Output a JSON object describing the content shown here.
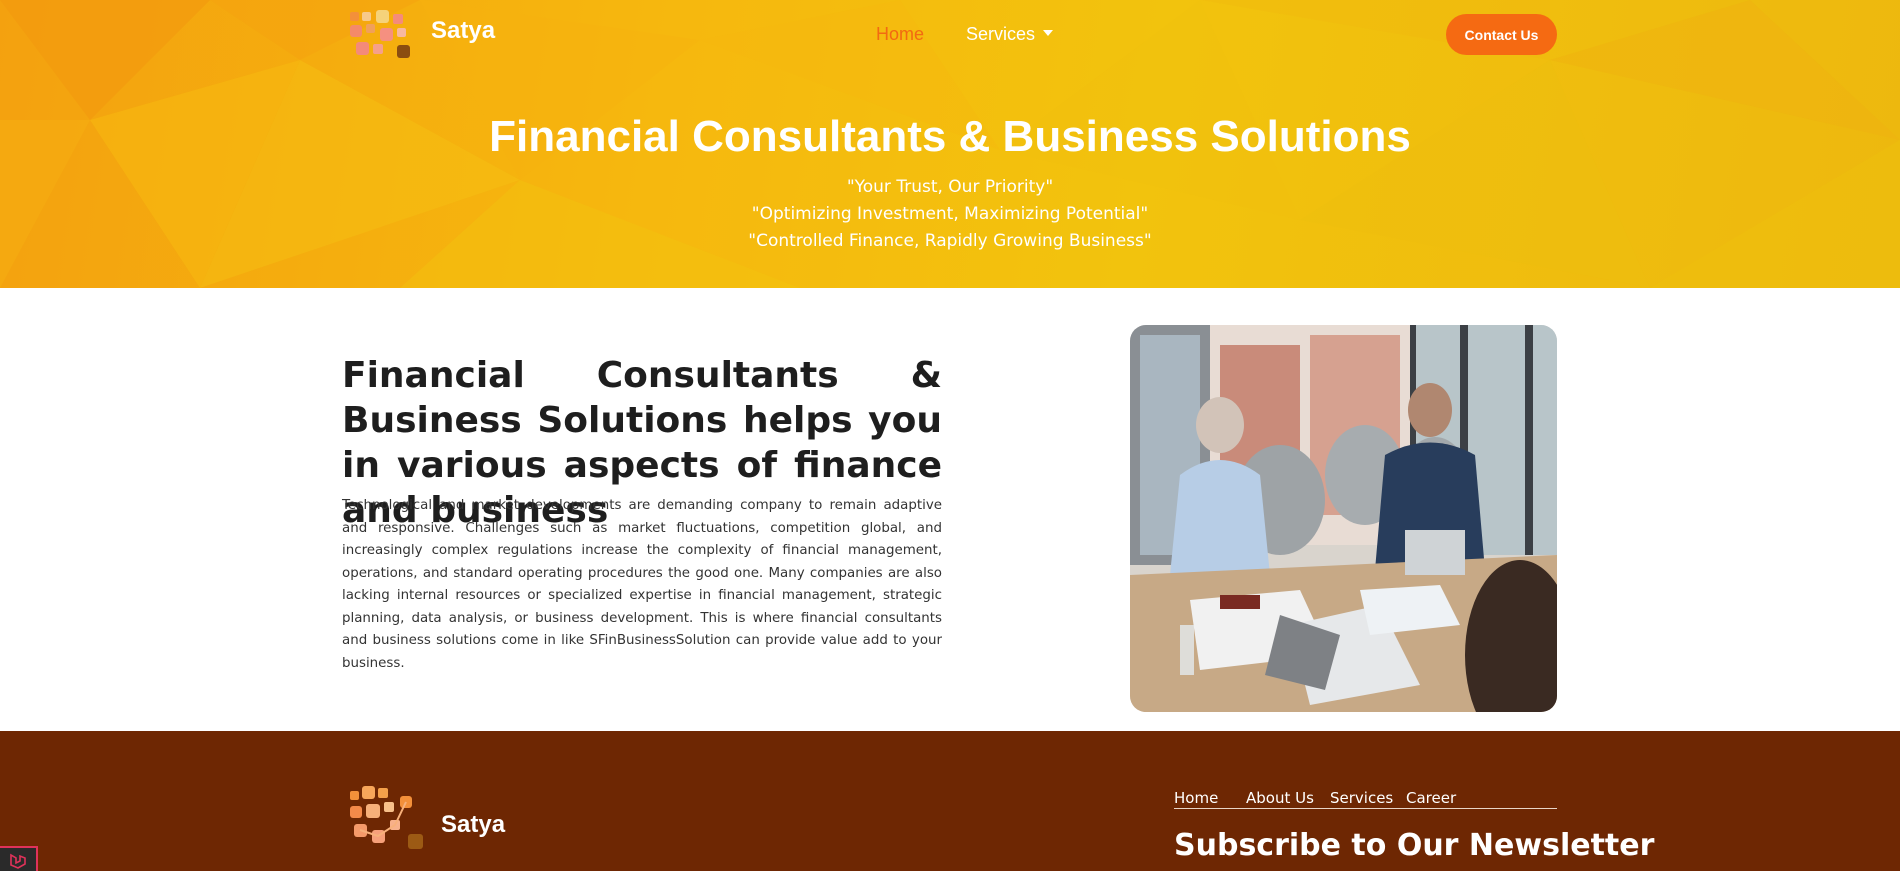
{
  "header": {
    "brand": "Satya",
    "nav": {
      "home": "Home",
      "services": "Services"
    },
    "contact_button": "Contact Us"
  },
  "hero": {
    "title": "Financial Consultants & Business Solutions",
    "taglines": [
      "\"Your Trust, Our Priority\"",
      "\"Optimizing Investment, Maximizing Potential\"",
      "\"Controlled Finance, Rapidly Growing Business\""
    ]
  },
  "about": {
    "heading": "Financial Consultants & Business Solutions helps you in various aspects of finance and business",
    "body": "Technological and market developments are demanding company to remain adaptive and responsive. Challenges such as market fluctuations, competition global, and increasingly complex regulations increase the complexity of financial management, operations, and standard operating procedures the good one. Many companies are also lacking internal resources or specialized expertise in financial management, strategic planning, data analysis, or business development. This is where financial consultants and business solutions come in like SFinBusinessSolution can provide value add to your business."
  },
  "footer": {
    "brand": "Satya",
    "links": [
      "Home",
      "About Us",
      "Services",
      "Career"
    ],
    "newsletter_title": "Subscribe to Our Newsletter"
  },
  "colors": {
    "accent": "#f56a12",
    "hero_yellow": "#f4b40e",
    "footer_brown": "#6e2703"
  }
}
